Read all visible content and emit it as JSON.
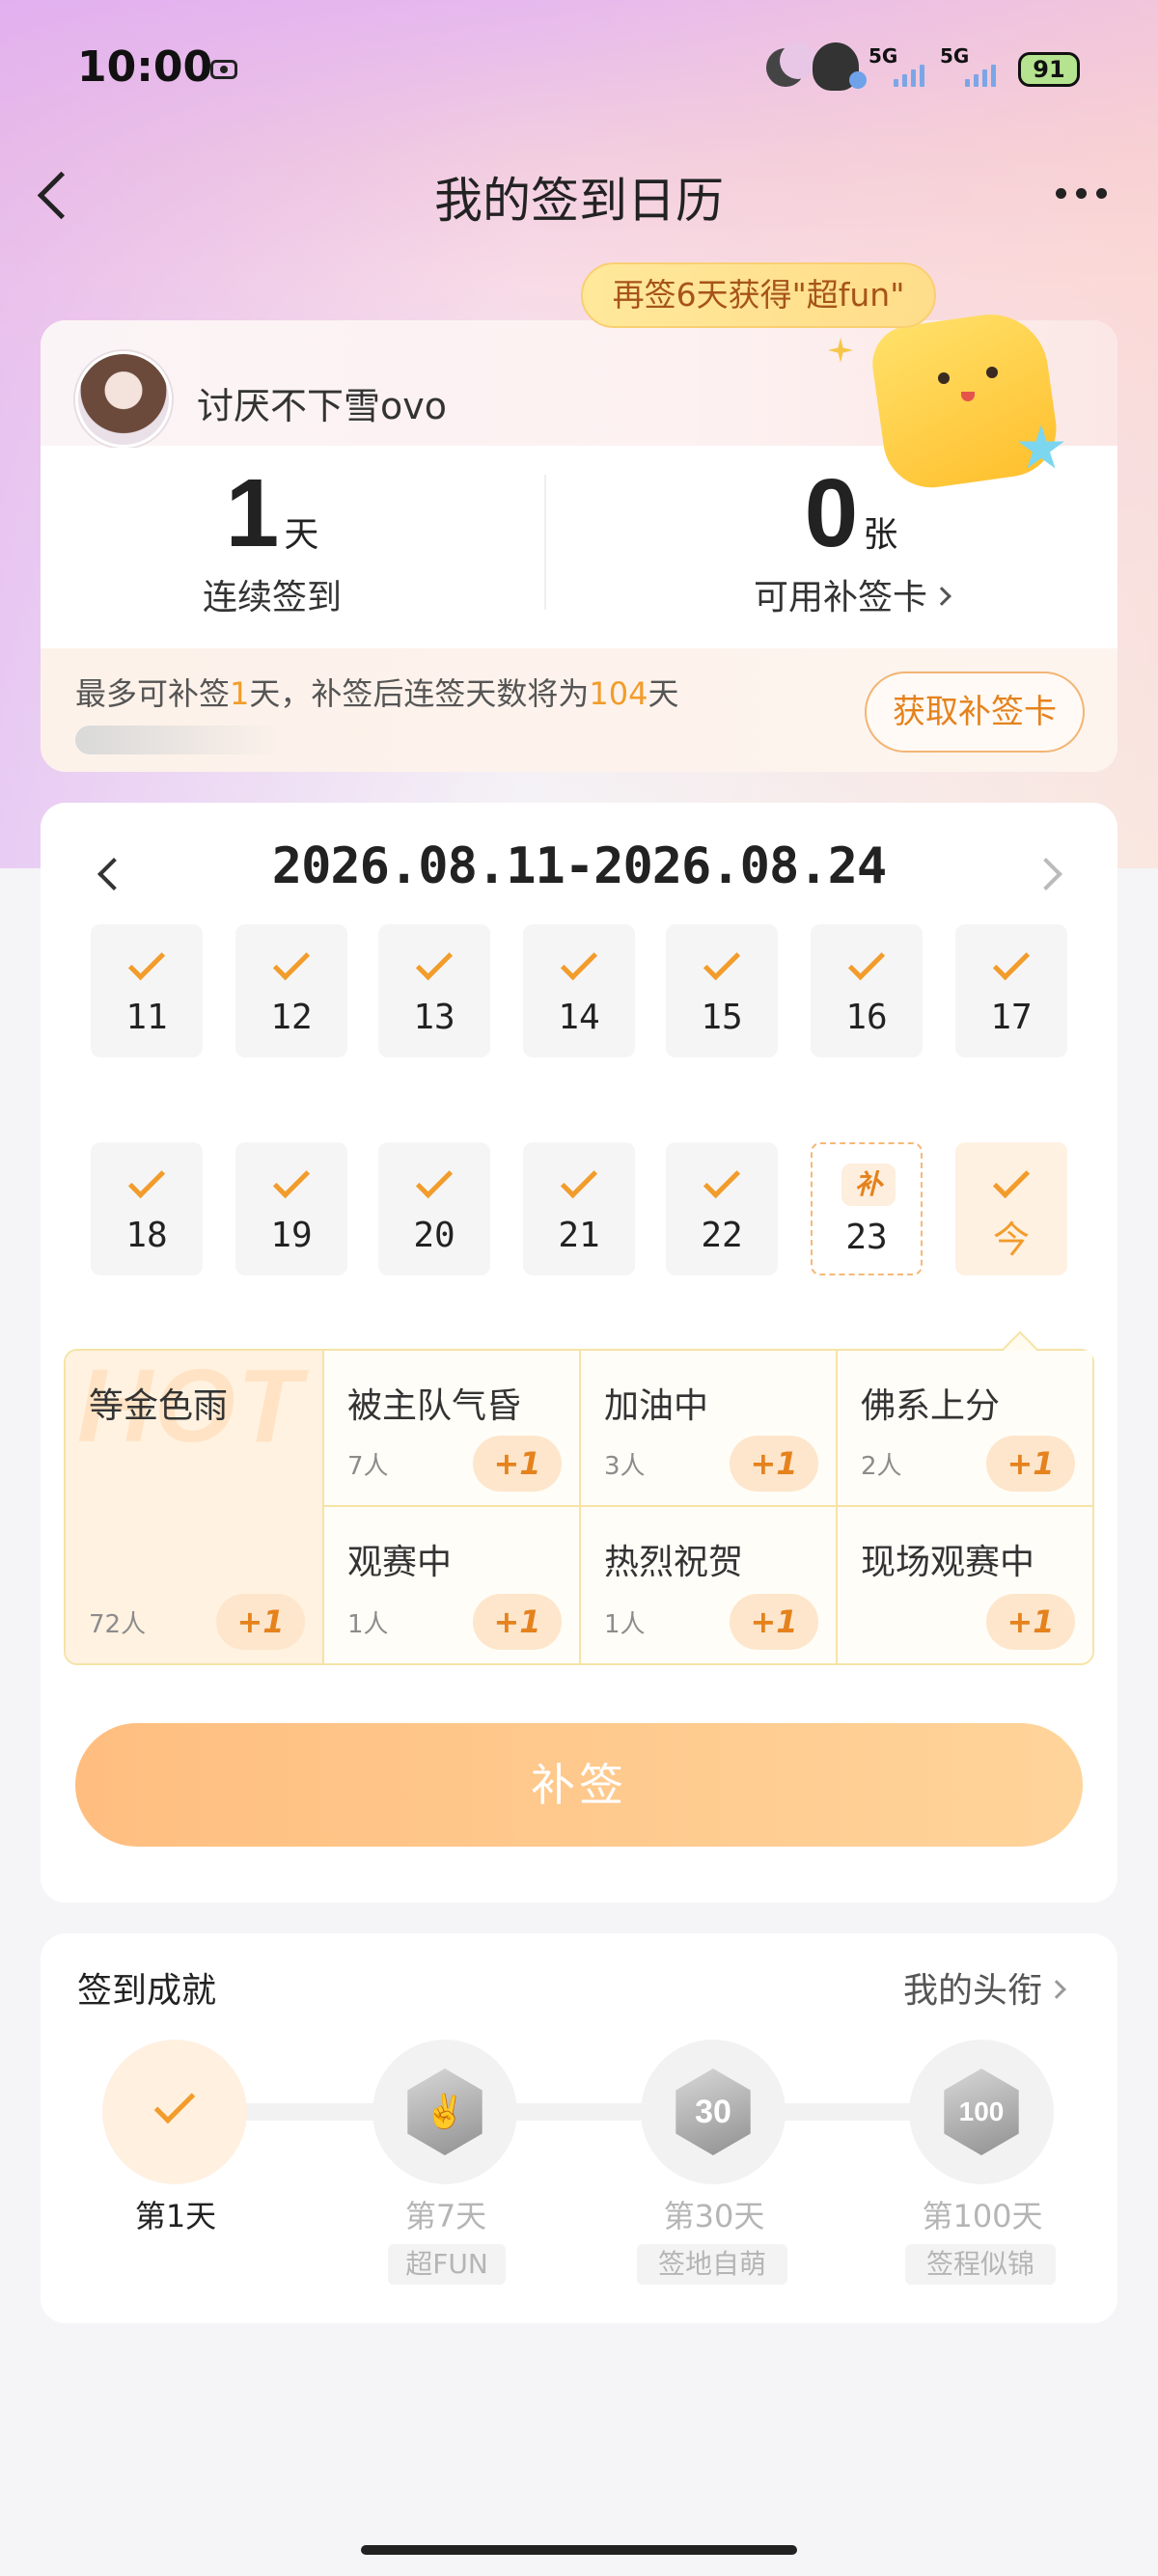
{
  "status_bar": {
    "time": "10:00",
    "network_1": "5G",
    "network_2": "5G",
    "battery": "91"
  },
  "nav": {
    "title": "我的签到日历"
  },
  "banner": {
    "text": "再签6天获得\"超fun\""
  },
  "user": {
    "name": "讨厌不下雪ovo"
  },
  "stats": {
    "streak_value": "1",
    "streak_unit": "天",
    "streak_label": "连续签到",
    "cards_value": "0",
    "cards_unit": "张",
    "cards_label": "可用补签卡"
  },
  "makeup_info": {
    "prefix": "最多可补签",
    "days": "1",
    "middle": "天，补签后连签天数将为",
    "result_days": "104",
    "suffix": "天",
    "get_card_label": "获取补签卡"
  },
  "calendar": {
    "range": "2026.08.11-2026.08.24",
    "row1": [
      "11",
      "12",
      "13",
      "14",
      "15",
      "16",
      "17"
    ],
    "row2": [
      "18",
      "19",
      "20",
      "21",
      "22"
    ],
    "makeup_badge": "补",
    "makeup_day": "23",
    "today_label": "今"
  },
  "moods": {
    "hot_watermark": "HOT",
    "featured": {
      "label": "等金色雨",
      "count": "72人",
      "plus": "+1"
    },
    "items": [
      {
        "label": "被主队气昏",
        "count": "7人",
        "plus": "+1"
      },
      {
        "label": "加油中",
        "count": "3人",
        "plus": "+1"
      },
      {
        "label": "佛系上分",
        "count": "2人",
        "plus": "+1"
      },
      {
        "label": "观赛中",
        "count": "1人",
        "plus": "+1"
      },
      {
        "label": "热烈祝贺",
        "count": "1人",
        "plus": "+1"
      },
      {
        "label": "现场观赛中",
        "count": "",
        "plus": "+1"
      }
    ]
  },
  "resign_button": "补签",
  "achievements": {
    "title": "签到成就",
    "link": "我的头衔",
    "milestones": [
      {
        "label": "第1天",
        "tag": ""
      },
      {
        "label": "第7天",
        "tag": "超FUN"
      },
      {
        "label": "第30天",
        "tag": "签地自萌"
      },
      {
        "label": "第100天",
        "tag": "签程似锦"
      }
    ],
    "medal_30": "30",
    "medal_100": "100"
  },
  "colors": {
    "accent": "#f29c2b",
    "button_gradient_start": "#ffbe80",
    "button_gradient_end": "#ffd49a"
  }
}
